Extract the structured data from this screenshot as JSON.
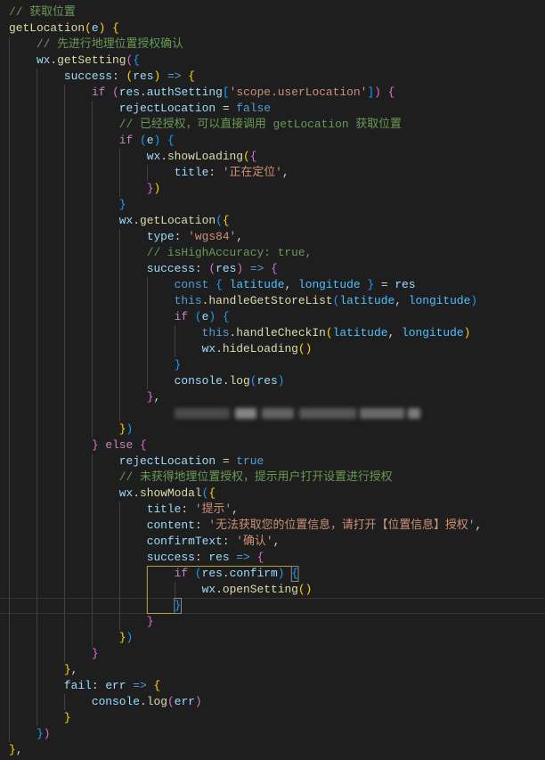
{
  "editor": {
    "background": "#1e1e1e",
    "palette": [
      "#d4d4d4",
      "#6a9955",
      "#dcdcaa",
      "#9cdcfe",
      "#c586c0",
      "#569cd6",
      "#ce9178",
      "#ffd700",
      "#da70d6",
      "#179fff",
      "#4fc1ff"
    ],
    "current_line": 38,
    "redacted_line": 26,
    "lines": [
      [
        [
          1,
          "// 获取位置"
        ]
      ],
      [
        [
          2,
          "getLocation"
        ],
        [
          7,
          "("
        ],
        [
          3,
          "e"
        ],
        [
          7,
          ")"
        ],
        [
          0,
          " "
        ],
        [
          7,
          "{"
        ]
      ],
      [
        [
          1,
          "    // 先进行地理位置授权确认"
        ]
      ],
      [
        [
          3,
          "    wx"
        ],
        [
          0,
          "."
        ],
        [
          2,
          "getSetting"
        ],
        [
          8,
          "("
        ],
        [
          9,
          "{"
        ]
      ],
      [
        [
          3,
          "        success"
        ],
        [
          0,
          ": "
        ],
        [
          7,
          "("
        ],
        [
          3,
          "res"
        ],
        [
          7,
          ")"
        ],
        [
          0,
          " "
        ],
        [
          5,
          "=>"
        ],
        [
          0,
          " "
        ],
        [
          7,
          "{"
        ]
      ],
      [
        [
          4,
          "            if"
        ],
        [
          0,
          " "
        ],
        [
          8,
          "("
        ],
        [
          3,
          "res"
        ],
        [
          0,
          "."
        ],
        [
          3,
          "authSetting"
        ],
        [
          9,
          "["
        ],
        [
          6,
          "'scope.userLocation'"
        ],
        [
          9,
          "]"
        ],
        [
          8,
          ")"
        ],
        [
          0,
          " "
        ],
        [
          8,
          "{"
        ]
      ],
      [
        [
          3,
          "                rejectLocation"
        ],
        [
          0,
          " = "
        ],
        [
          5,
          "false"
        ]
      ],
      [
        [
          1,
          "                // 已经授权，可以直接调用 getLocation 获取位置"
        ]
      ],
      [
        [
          4,
          "                if"
        ],
        [
          0,
          " "
        ],
        [
          9,
          "("
        ],
        [
          3,
          "e"
        ],
        [
          9,
          ")"
        ],
        [
          0,
          " "
        ],
        [
          9,
          "{"
        ]
      ],
      [
        [
          3,
          "                    wx"
        ],
        [
          0,
          "."
        ],
        [
          2,
          "showLoading"
        ],
        [
          7,
          "("
        ],
        [
          8,
          "{"
        ]
      ],
      [
        [
          3,
          "                        title"
        ],
        [
          0,
          ": "
        ],
        [
          6,
          "'正在定位'"
        ],
        [
          0,
          ","
        ]
      ],
      [
        [
          8,
          "                    }"
        ],
        [
          7,
          ")"
        ]
      ],
      [
        [
          9,
          "                }"
        ]
      ],
      [
        [
          3,
          "                wx"
        ],
        [
          0,
          "."
        ],
        [
          2,
          "getLocation"
        ],
        [
          9,
          "("
        ],
        [
          7,
          "{"
        ]
      ],
      [
        [
          3,
          "                    type"
        ],
        [
          0,
          ": "
        ],
        [
          6,
          "'wgs84'"
        ],
        [
          0,
          ","
        ]
      ],
      [
        [
          1,
          "                    // isHighAccuracy: true,"
        ]
      ],
      [
        [
          3,
          "                    success"
        ],
        [
          0,
          ": "
        ],
        [
          8,
          "("
        ],
        [
          3,
          "res"
        ],
        [
          8,
          ")"
        ],
        [
          0,
          " "
        ],
        [
          5,
          "=>"
        ],
        [
          0,
          " "
        ],
        [
          8,
          "{"
        ]
      ],
      [
        [
          5,
          "                        const"
        ],
        [
          0,
          " "
        ],
        [
          9,
          "{"
        ],
        [
          0,
          " "
        ],
        [
          10,
          "latitude"
        ],
        [
          0,
          ", "
        ],
        [
          10,
          "longitude"
        ],
        [
          0,
          " "
        ],
        [
          9,
          "}"
        ],
        [
          0,
          " = "
        ],
        [
          3,
          "res"
        ]
      ],
      [
        [
          5,
          "                        this"
        ],
        [
          0,
          "."
        ],
        [
          2,
          "handleGetStoreList"
        ],
        [
          9,
          "("
        ],
        [
          10,
          "latitude"
        ],
        [
          0,
          ", "
        ],
        [
          10,
          "longitude"
        ],
        [
          9,
          ")"
        ]
      ],
      [
        [
          4,
          "                        if"
        ],
        [
          0,
          " "
        ],
        [
          9,
          "("
        ],
        [
          3,
          "e"
        ],
        [
          9,
          ")"
        ],
        [
          0,
          " "
        ],
        [
          9,
          "{"
        ]
      ],
      [
        [
          5,
          "                            this"
        ],
        [
          0,
          "."
        ],
        [
          2,
          "handleCheckIn"
        ],
        [
          7,
          "("
        ],
        [
          10,
          "latitude"
        ],
        [
          0,
          ", "
        ],
        [
          10,
          "longitude"
        ],
        [
          7,
          ")"
        ]
      ],
      [
        [
          3,
          "                            wx"
        ],
        [
          0,
          "."
        ],
        [
          2,
          "hideLoading"
        ],
        [
          7,
          "()"
        ]
      ],
      [
        [
          9,
          "                        }"
        ]
      ],
      [
        [
          3,
          "                        console"
        ],
        [
          0,
          "."
        ],
        [
          2,
          "log"
        ],
        [
          9,
          "("
        ],
        [
          3,
          "res"
        ],
        [
          9,
          ")"
        ]
      ],
      [
        [
          8,
          "                    }"
        ],
        [
          0,
          ","
        ]
      ],
      [],
      [
        [
          7,
          "                }"
        ],
        [
          9,
          ")"
        ]
      ],
      [
        [
          8,
          "            }"
        ],
        [
          0,
          " "
        ],
        [
          4,
          "else"
        ],
        [
          0,
          " "
        ],
        [
          8,
          "{"
        ]
      ],
      [
        [
          3,
          "                rejectLocation"
        ],
        [
          0,
          " = "
        ],
        [
          5,
          "true"
        ]
      ],
      [
        [
          1,
          "                // 未获得地理位置授权，提示用户打开设置进行授权"
        ]
      ],
      [
        [
          3,
          "                wx"
        ],
        [
          0,
          "."
        ],
        [
          2,
          "showModal"
        ],
        [
          9,
          "("
        ],
        [
          7,
          "{"
        ]
      ],
      [
        [
          3,
          "                    title"
        ],
        [
          0,
          ": "
        ],
        [
          6,
          "'提示'"
        ],
        [
          0,
          ","
        ]
      ],
      [
        [
          3,
          "                    content"
        ],
        [
          0,
          ": "
        ],
        [
          6,
          "'无法获取您的位置信息，请打开【位置信息】授权'"
        ],
        [
          0,
          ","
        ]
      ],
      [
        [
          3,
          "                    confirmText"
        ],
        [
          0,
          ": "
        ],
        [
          6,
          "'确认'"
        ],
        [
          0,
          ","
        ]
      ],
      [
        [
          3,
          "                    success"
        ],
        [
          0,
          ": "
        ],
        [
          3,
          "res"
        ],
        [
          0,
          " "
        ],
        [
          5,
          "=>"
        ],
        [
          0,
          " "
        ],
        [
          8,
          "{"
        ]
      ],
      [
        [
          4,
          "                        if"
        ],
        [
          0,
          " "
        ],
        [
          9,
          "("
        ],
        [
          3,
          "res"
        ],
        [
          0,
          "."
        ],
        [
          3,
          "confirm"
        ],
        [
          9,
          ")"
        ],
        [
          0,
          " "
        ],
        [
          9,
          "{"
        ]
      ],
      [
        [
          3,
          "                            wx"
        ],
        [
          0,
          "."
        ],
        [
          2,
          "openSetting"
        ],
        [
          7,
          "()"
        ]
      ],
      [
        [
          9,
          "                        }"
        ]
      ],
      [
        [
          8,
          "                    }"
        ]
      ],
      [
        [
          7,
          "                }"
        ],
        [
          9,
          ")"
        ]
      ],
      [
        [
          8,
          "            }"
        ]
      ],
      [
        [
          7,
          "        }"
        ],
        [
          0,
          ","
        ]
      ],
      [
        [
          3,
          "        fail"
        ],
        [
          0,
          ": "
        ],
        [
          3,
          "err"
        ],
        [
          0,
          " "
        ],
        [
          5,
          "=>"
        ],
        [
          0,
          " "
        ],
        [
          7,
          "{"
        ]
      ],
      [
        [
          3,
          "            console"
        ],
        [
          0,
          "."
        ],
        [
          2,
          "log"
        ],
        [
          8,
          "("
        ],
        [
          3,
          "err"
        ],
        [
          8,
          ")"
        ]
      ],
      [
        [
          7,
          "        }"
        ]
      ],
      [
        [
          9,
          "    }"
        ],
        [
          8,
          ")"
        ]
      ],
      [
        [
          7,
          "}"
        ],
        [
          0,
          ","
        ]
      ]
    ]
  }
}
